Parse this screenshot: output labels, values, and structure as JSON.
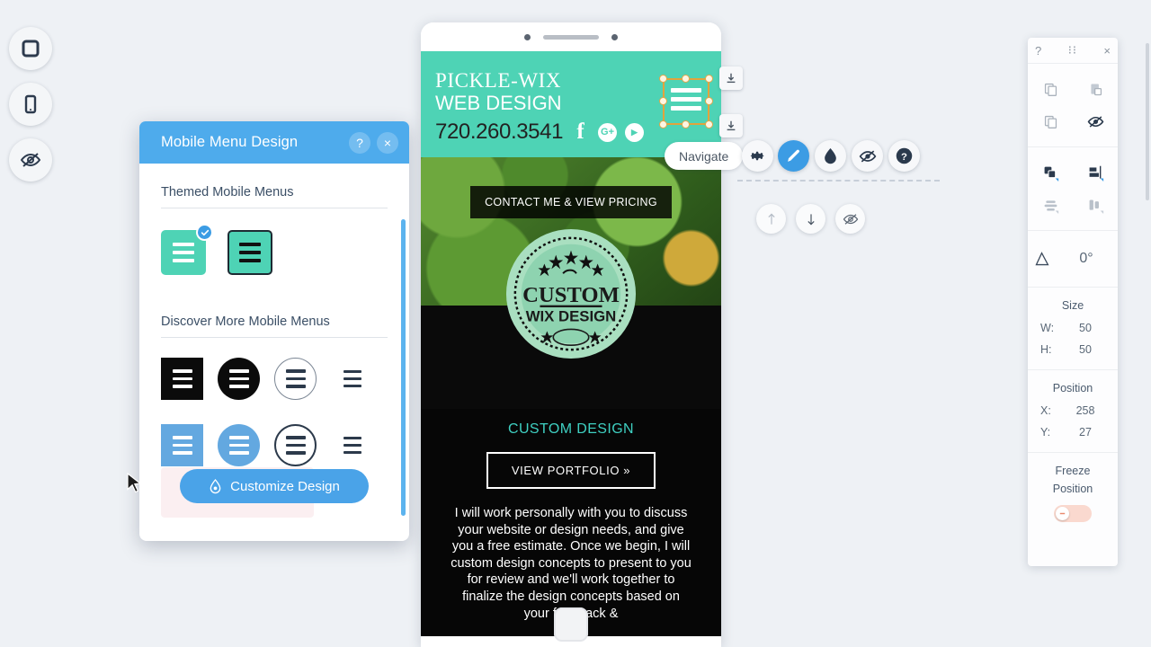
{
  "left_rail": [
    {
      "name": "desktop-view",
      "icon": "square-icon"
    },
    {
      "name": "mobile-view",
      "icon": "mobile-phone-icon"
    },
    {
      "name": "hidden-elements",
      "icon": "eye-hidden-icon"
    }
  ],
  "dialog": {
    "title": "Mobile Menu Design",
    "help_label": "?",
    "close_label": "×",
    "themed_section_title": "Themed Mobile Menus",
    "discover_section_title": "Discover More Mobile Menus",
    "themed": [
      {
        "name": "themed-menu-1",
        "selected": true,
        "bg": "#4ed3b5",
        "line": "#ffffff",
        "shape": "square"
      },
      {
        "name": "themed-menu-2",
        "selected": false,
        "bg": "#4ed3b5",
        "line": "#111111",
        "shape": "square-outlined"
      }
    ],
    "discover": [
      {
        "name": "menu-black-square",
        "shape": "square",
        "bg": "#0b0b0b",
        "line": "#ffffff"
      },
      {
        "name": "menu-black-circle",
        "shape": "circle",
        "bg": "#0b0b0b",
        "line": "#ffffff"
      },
      {
        "name": "menu-black-outline-circle",
        "shape": "circle-outline",
        "bg": "transparent",
        "line": "#2c3a4b",
        "border": "#7b8694"
      },
      {
        "name": "menu-black-lines",
        "shape": "bare",
        "bg": "transparent",
        "line": "#2c3a4b"
      },
      {
        "name": "menu-blue-square",
        "shape": "square",
        "bg": "#63a8e0",
        "line": "#ffffff"
      },
      {
        "name": "menu-blue-circle",
        "shape": "circle",
        "bg": "#63a8e0",
        "line": "#ffffff"
      },
      {
        "name": "menu-blue-outline-circle",
        "shape": "circle-outline",
        "bg": "transparent",
        "line": "#2c3a4b",
        "border": "#2c3a4b"
      },
      {
        "name": "menu-blue-lines",
        "shape": "bare",
        "bg": "transparent",
        "line": "#2c3a4b"
      }
    ],
    "customize_label": "Customize Design",
    "customize_icon": "droplet-icon"
  },
  "phone": {
    "site": {
      "brand_line1": "PICKLE-WIX",
      "brand_line2": "WEB DESIGN",
      "phone_number": "720.260.3541",
      "social": [
        {
          "name": "facebook-icon",
          "glyph": "f"
        },
        {
          "name": "google-plus-icon",
          "glyph": "G+"
        },
        {
          "name": "youtube-icon",
          "glyph": "▶"
        }
      ],
      "cta_banner": "CONTACT ME & VIEW PRICING",
      "badge_top": "CUSTOM",
      "badge_bottom": "WIX DESIGN",
      "section_title": "CUSTOM DESIGN",
      "portfolio_button": "VIEW PORTFOLIO »",
      "body_copy": "I will work personally with you to discuss your website or design needs, and give you a free estimate. Once we begin, I will custom design concepts to present to you for review and we'll work together to finalize the design concepts based on your feedback &",
      "header_color": "#4ed3b5",
      "accent_color": "#3fd0c2"
    }
  },
  "toolbar": {
    "navigate_label": "Navigate",
    "buttons": [
      {
        "name": "settings-button",
        "icon": "gear-icon",
        "active": false
      },
      {
        "name": "design-button",
        "icon": "pen-icon",
        "active": true
      },
      {
        "name": "color-button",
        "icon": "droplet-icon",
        "active": false
      },
      {
        "name": "hide-button",
        "icon": "eye-hidden-icon",
        "active": false
      },
      {
        "name": "help-button",
        "icon": "question-mark-icon",
        "active": false
      }
    ]
  },
  "order_controls": [
    {
      "name": "move-up-button",
      "icon": "arrow-up-icon"
    },
    {
      "name": "move-down-button",
      "icon": "arrow-down-icon"
    },
    {
      "name": "hide-element-button",
      "icon": "eye-hidden-icon"
    }
  ],
  "dock_buttons": [
    {
      "name": "dock-down-button-1",
      "icon": "download-arrow-icon"
    },
    {
      "name": "dock-down-button-2",
      "icon": "download-arrow-icon"
    }
  ],
  "panel": {
    "help_label": "?",
    "drag_label": "∷",
    "close_label": "×",
    "tools_row1": [
      {
        "name": "copy-button",
        "icon": "copy-icon"
      },
      {
        "name": "paste-button",
        "icon": "paste-icon"
      }
    ],
    "tools_row2": [
      {
        "name": "duplicate-button",
        "icon": "duplicate-icon"
      },
      {
        "name": "hide-button",
        "icon": "eye-hidden-icon"
      }
    ],
    "arrange_row1": [
      {
        "name": "arrange-button",
        "icon": "arrange-icon"
      },
      {
        "name": "align-button",
        "icon": "align-icon"
      }
    ],
    "arrange_row2": [
      {
        "name": "distribute-horizontal-button",
        "icon": "distribute-h-icon"
      },
      {
        "name": "distribute-vertical-button",
        "icon": "distribute-v-icon"
      }
    ],
    "rotation_icon": "angle-icon",
    "rotation_value": "0°",
    "size_label": "Size",
    "width_key": "W:",
    "width_value": "50",
    "height_key": "H:",
    "height_value": "50",
    "position_label": "Position",
    "x_key": "X:",
    "x_value": "258",
    "y_key": "Y:",
    "y_value": "27",
    "freeze_label_line1": "Freeze",
    "freeze_label_line2": "Position",
    "freeze_on": false
  }
}
